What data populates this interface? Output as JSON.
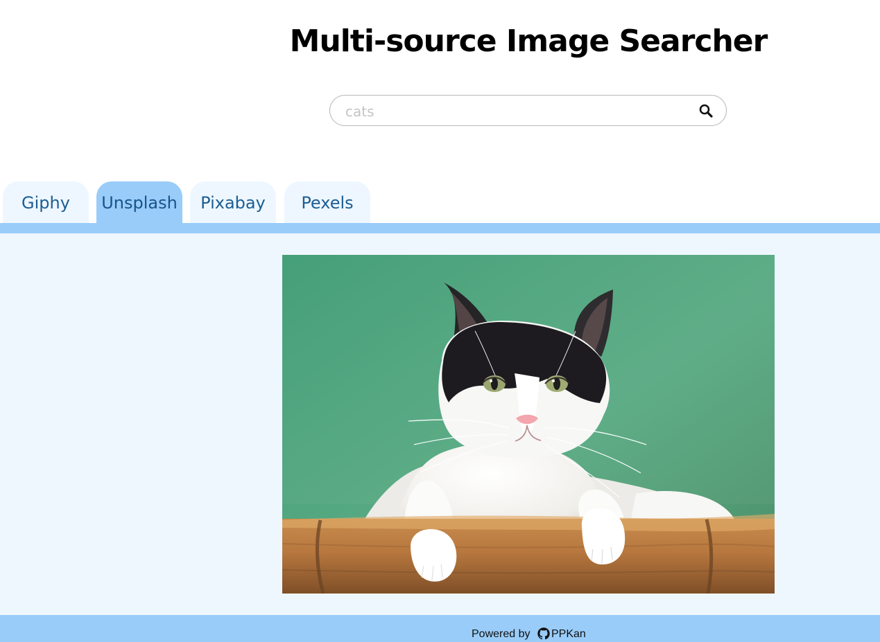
{
  "header": {
    "title": "Multi-source Image Searcher"
  },
  "search": {
    "value": "",
    "placeholder": "cats",
    "button_icon": "search-icon"
  },
  "tabs": [
    {
      "label": "Giphy",
      "active": false
    },
    {
      "label": "Unsplash",
      "active": true
    },
    {
      "label": "Pixabay",
      "active": false
    },
    {
      "label": "Pexels",
      "active": false
    }
  ],
  "results": {
    "image_subject": "cat"
  },
  "footer": {
    "powered_by": "Powered by",
    "github_icon": "github-icon",
    "author_link": "PPKan"
  },
  "colors": {
    "accent": "#99ccf9",
    "content_background": "#eff7fe",
    "tab_text": "#1b5e95",
    "inactive_tab": "#eef7ff"
  }
}
